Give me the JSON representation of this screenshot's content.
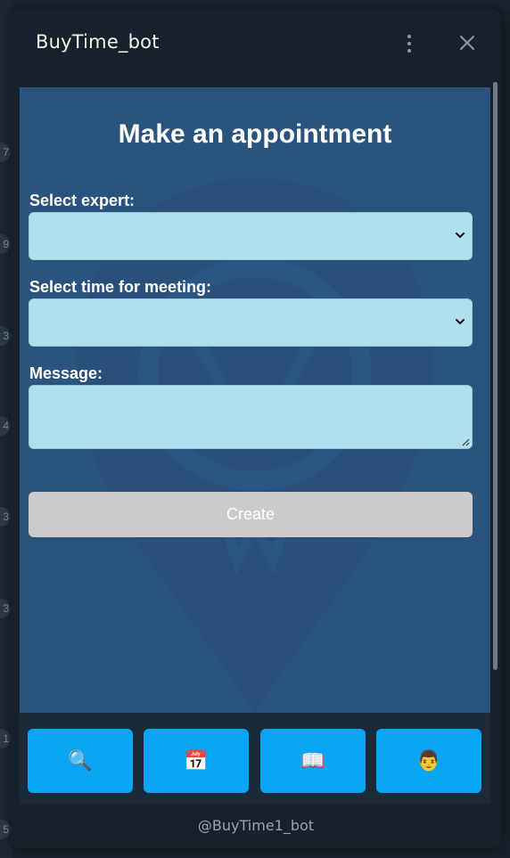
{
  "window": {
    "title": "BuyTime_bot"
  },
  "form": {
    "heading": "Make an appointment",
    "expert_label": "Select expert:",
    "expert_value": "",
    "time_label": "Select time for meeting:",
    "time_value": "",
    "message_label": "Message:",
    "message_value": "",
    "create_label": "Create"
  },
  "nav": {
    "buttons": [
      {
        "icon": "search-icon",
        "glyph": "🔍"
      },
      {
        "icon": "calendar-icon",
        "glyph": "📅"
      },
      {
        "icon": "book-icon",
        "glyph": "📖"
      },
      {
        "icon": "person-icon",
        "glyph": "👨"
      }
    ]
  },
  "footer": {
    "username": "@BuyTime1_bot"
  },
  "background": {
    "counts": [
      "7",
      "9",
      "3",
      "4",
      "3",
      "3",
      "1",
      "5"
    ]
  },
  "colors": {
    "content_bg": "#2a547d",
    "field_bg": "#b0e0ec",
    "nav_button": "#0aa5f5",
    "create_disabled": "#cccccc"
  }
}
